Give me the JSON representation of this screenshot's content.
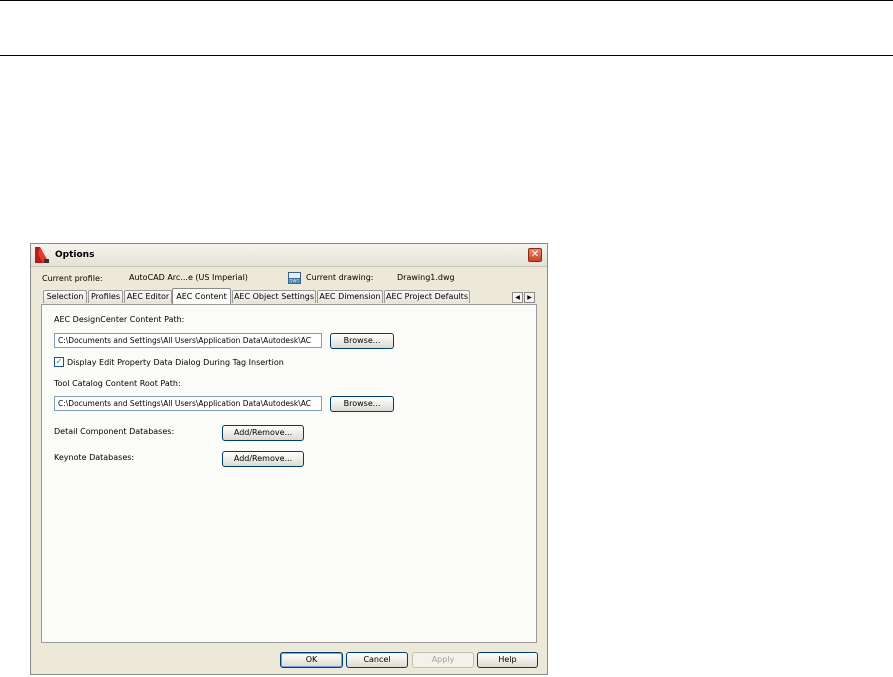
{
  "dialog": {
    "title": "Options",
    "close_glyph": "✕",
    "profile_label": "Current profile:",
    "profile_value": "AutoCAD Arc...e (US Imperial)",
    "drawing_label": "Current drawing:",
    "drawing_value": "Drawing1.dwg",
    "tabs": [
      {
        "label": "Selection",
        "active": false
      },
      {
        "label": "Profiles",
        "active": false
      },
      {
        "label": "AEC Editor",
        "active": false
      },
      {
        "label": "AEC Content",
        "active": true
      },
      {
        "label": "AEC Object Settings",
        "active": false
      },
      {
        "label": "AEC Dimension",
        "active": false
      },
      {
        "label": "AEC Project Defaults",
        "active": false
      }
    ],
    "tab_scroll": {
      "left": "◀",
      "right": "▶"
    },
    "content": {
      "designcenter_label": "AEC DesignCenter Content Path:",
      "designcenter_path": "C:\\Documents and Settings\\All Users\\Application Data\\Autodesk\\AC",
      "browse_label": "Browse...",
      "checkbox_label": "Display Edit Property Data Dialog During Tag Insertion",
      "checkbox_checked": true,
      "tool_catalog_label": "Tool Catalog Content Root Path:",
      "tool_catalog_path": "C:\\Documents and Settings\\All Users\\Application Data\\Autodesk\\AC",
      "detail_label": "Detail Component Databases:",
      "keynote_label": "Keynote Databases:",
      "add_remove_label": "Add/Remove..."
    },
    "buttons": {
      "ok": "OK",
      "cancel": "Cancel",
      "apply": "Apply",
      "help": "Help"
    }
  },
  "colors": {
    "accent": "#c8452a",
    "panel": "#fbfbf8",
    "chrome": "#ece9d8"
  }
}
